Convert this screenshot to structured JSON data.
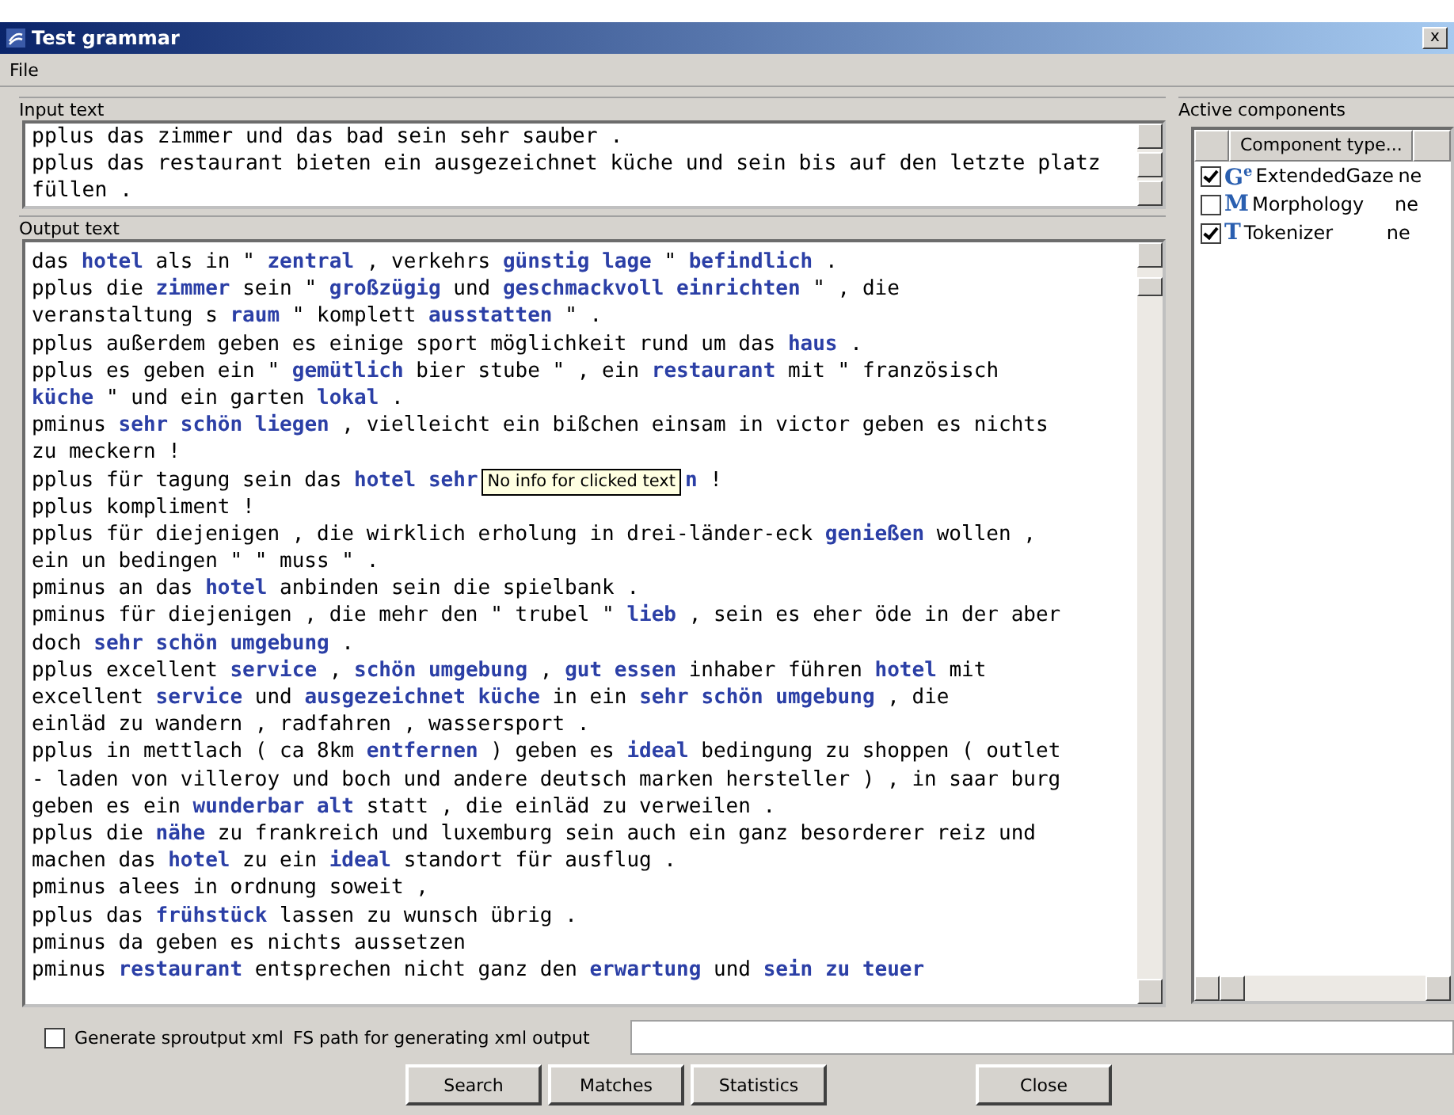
{
  "window": {
    "title": "Test grammar",
    "close": "x"
  },
  "menu": [
    "File"
  ],
  "input": {
    "label": "Input text",
    "lines": [
      "pplus das zimmer und das bad sein sehr sauber .",
      "pplus das restaurant bieten ein ausgezeichnet küche und sein bis auf den letzte platz",
      "füllen ."
    ]
  },
  "output": {
    "label": "Output text",
    "lines": [
      {
        "segments": [
          {
            "text": "das ",
            "highlighted": false
          },
          {
            "text": "hotel",
            "highlighted": true
          },
          {
            "text": " als in \" ",
            "highlighted": false
          },
          {
            "text": "zentral",
            "highlighted": true
          },
          {
            "text": " , verkehrs ",
            "highlighted": false
          },
          {
            "text": "günstig lage",
            "highlighted": true
          },
          {
            "text": " \" ",
            "highlighted": false
          },
          {
            "text": "befindlich",
            "highlighted": true
          },
          {
            "text": " .",
            "highlighted": false
          }
        ]
      },
      {
        "segments": [
          {
            "text": "pplus die ",
            "highlighted": false
          },
          {
            "text": "zimmer",
            "highlighted": true
          },
          {
            "text": " sein \" ",
            "highlighted": false
          },
          {
            "text": "großzügig",
            "highlighted": true
          },
          {
            "text": " und ",
            "highlighted": false
          },
          {
            "text": "geschmackvoll einrichten",
            "highlighted": true
          },
          {
            "text": " \" , die",
            "highlighted": false
          }
        ]
      },
      {
        "segments": [
          {
            "text": "veranstaltung s ",
            "highlighted": false
          },
          {
            "text": "raum",
            "highlighted": true
          },
          {
            "text": " \" komplett ",
            "highlighted": false
          },
          {
            "text": "ausstatten",
            "highlighted": true
          },
          {
            "text": " \" .",
            "highlighted": false
          }
        ]
      },
      {
        "segments": [
          {
            "text": "pplus außerdem geben es einige sport möglichkeit rund um das ",
            "highlighted": false
          },
          {
            "text": "haus",
            "highlighted": true
          },
          {
            "text": " .",
            "highlighted": false
          }
        ]
      },
      {
        "segments": [
          {
            "text": "pplus es geben ein \" ",
            "highlighted": false
          },
          {
            "text": "gemütlich",
            "highlighted": true
          },
          {
            "text": " bier stube \" , ein ",
            "highlighted": false
          },
          {
            "text": "restaurant",
            "highlighted": true
          },
          {
            "text": " mit \" französisch",
            "highlighted": false
          }
        ]
      },
      {
        "segments": [
          {
            "text": "küche",
            "highlighted": true
          },
          {
            "text": " \" und ein garten ",
            "highlighted": false
          },
          {
            "text": "lokal",
            "highlighted": true
          },
          {
            "text": " .",
            "highlighted": false
          }
        ]
      },
      {
        "segments": [
          {
            "text": "pminus ",
            "highlighted": false
          },
          {
            "text": "sehr schön liegen",
            "highlighted": true
          },
          {
            "text": " , vielleicht ein bißchen einsam in victor geben es nichts",
            "highlighted": false
          }
        ]
      },
      {
        "segments": [
          {
            "text": "zu meckern !",
            "highlighted": false
          }
        ]
      },
      {
        "segments": [
          {
            "text": "pplus für tagung sein das ",
            "highlighted": false
          },
          {
            "text": "hotel sehr",
            "highlighted": true
          },
          {
            "kind": "tooltip",
            "text": "No info for clicked text"
          },
          {
            "text": "n",
            "highlighted": true
          },
          {
            "text": " !",
            "highlighted": false
          }
        ]
      },
      {
        "segments": [
          {
            "text": "pplus kompliment !",
            "highlighted": false
          }
        ]
      },
      {
        "segments": [
          {
            "text": "pplus für diejenigen , die wirklich erholung in drei-länder-eck ",
            "highlighted": false
          },
          {
            "text": "genießen",
            "highlighted": true
          },
          {
            "text": " wollen ,",
            "highlighted": false
          }
        ]
      },
      {
        "segments": [
          {
            "text": "ein un bedingen \" \" muss \" .",
            "highlighted": false
          }
        ]
      },
      {
        "segments": [
          {
            "text": "pminus an das ",
            "highlighted": false
          },
          {
            "text": "hotel",
            "highlighted": true
          },
          {
            "text": " anbinden sein die spielbank .",
            "highlighted": false
          }
        ]
      },
      {
        "segments": [
          {
            "text": "pminus für diejenigen , die mehr den \" trubel \" ",
            "highlighted": false
          },
          {
            "text": "lieb",
            "highlighted": true
          },
          {
            "text": " , sein es eher öde in der aber",
            "highlighted": false
          }
        ]
      },
      {
        "segments": [
          {
            "text": "doch ",
            "highlighted": false
          },
          {
            "text": "sehr schön umgebung",
            "highlighted": true
          },
          {
            "text": " .",
            "highlighted": false
          }
        ]
      },
      {
        "segments": [
          {
            "text": "pplus excellent ",
            "highlighted": false
          },
          {
            "text": "service",
            "highlighted": true
          },
          {
            "text": " , ",
            "highlighted": false
          },
          {
            "text": "schön umgebung",
            "highlighted": true
          },
          {
            "text": " , ",
            "highlighted": false
          },
          {
            "text": "gut essen",
            "highlighted": true
          },
          {
            "text": " inhaber führen ",
            "highlighted": false
          },
          {
            "text": "hotel",
            "highlighted": true
          },
          {
            "text": " mit",
            "highlighted": false
          }
        ]
      },
      {
        "segments": [
          {
            "text": "excellent ",
            "highlighted": false
          },
          {
            "text": "service",
            "highlighted": true
          },
          {
            "text": " und ",
            "highlighted": false
          },
          {
            "text": "ausgezeichnet küche",
            "highlighted": true
          },
          {
            "text": " in ein ",
            "highlighted": false
          },
          {
            "text": "sehr schön umgebung",
            "highlighted": true
          },
          {
            "text": " , die",
            "highlighted": false
          }
        ]
      },
      {
        "segments": [
          {
            "text": "einläd zu wandern , radfahren , wassersport .",
            "highlighted": false
          }
        ]
      },
      {
        "segments": [
          {
            "text": "pplus in mettlach ( ca 8km ",
            "highlighted": false
          },
          {
            "text": "entfernen",
            "highlighted": true
          },
          {
            "text": " ) geben es ",
            "highlighted": false
          },
          {
            "text": "ideal",
            "highlighted": true
          },
          {
            "text": " bedingung zu shoppen ( outlet",
            "highlighted": false
          }
        ]
      },
      {
        "segments": [
          {
            "text": "- laden von villeroy und boch und andere deutsch marken hersteller ) , in saar burg",
            "highlighted": false
          }
        ]
      },
      {
        "segments": [
          {
            "text": "geben es ein ",
            "highlighted": false
          },
          {
            "text": "wunderbar alt",
            "highlighted": true
          },
          {
            "text": " statt , die einläd zu verweilen .",
            "highlighted": false
          }
        ]
      },
      {
        "segments": [
          {
            "text": "pplus die ",
            "highlighted": false
          },
          {
            "text": "nähe",
            "highlighted": true
          },
          {
            "text": " zu frankreich und luxemburg sein auch ein ganz besorderer reiz und",
            "highlighted": false
          }
        ]
      },
      {
        "segments": [
          {
            "text": "machen das ",
            "highlighted": false
          },
          {
            "text": "hotel",
            "highlighted": true
          },
          {
            "text": " zu ein ",
            "highlighted": false
          },
          {
            "text": "ideal",
            "highlighted": true
          },
          {
            "text": " standort für ausflug .",
            "highlighted": false
          }
        ]
      },
      {
        "segments": [
          {
            "text": "pminus alees in ordnung soweit ,",
            "highlighted": false
          }
        ]
      },
      {
        "segments": [
          {
            "text": "pplus das ",
            "highlighted": false
          },
          {
            "text": "frühstück",
            "highlighted": true
          },
          {
            "text": " lassen zu wunsch übrig .",
            "highlighted": false
          }
        ]
      },
      {
        "segments": [
          {
            "text": "pminus da geben es nichts aussetzen",
            "highlighted": false
          }
        ]
      },
      {
        "segments": [
          {
            "text": "pminus ",
            "highlighted": false
          },
          {
            "text": "restaurant",
            "highlighted": true
          },
          {
            "text": " entsprechen nicht ganz den ",
            "highlighted": false
          },
          {
            "text": "erwartung",
            "highlighted": true
          },
          {
            "text": " und ",
            "highlighted": false
          },
          {
            "text": "sein zu teuer",
            "highlighted": true
          }
        ]
      }
    ]
  },
  "components": {
    "label": "Active components",
    "columns": [
      "Component type..."
    ],
    "rows": [
      {
        "checked": true,
        "icon": "G$^{e}$",
        "name": "ExtendedGaze",
        "column_2": "ne"
      },
      {
        "checked": false,
        "icon": "M",
        "name": "Morphology",
        "column_2": "ne"
      },
      {
        "checked": true,
        "icon": "T",
        "name": "Tokenizer",
        "column_2": "ne"
      }
    ]
  },
  "options": {
    "generate_xml": {
      "label": "Generate sproutput xml",
      "checked": false
    },
    "path_label": "FS path for generating xml output"
  },
  "buttons": [
    "Search",
    "Matches",
    "Statistics",
    "Close"
  ]
}
